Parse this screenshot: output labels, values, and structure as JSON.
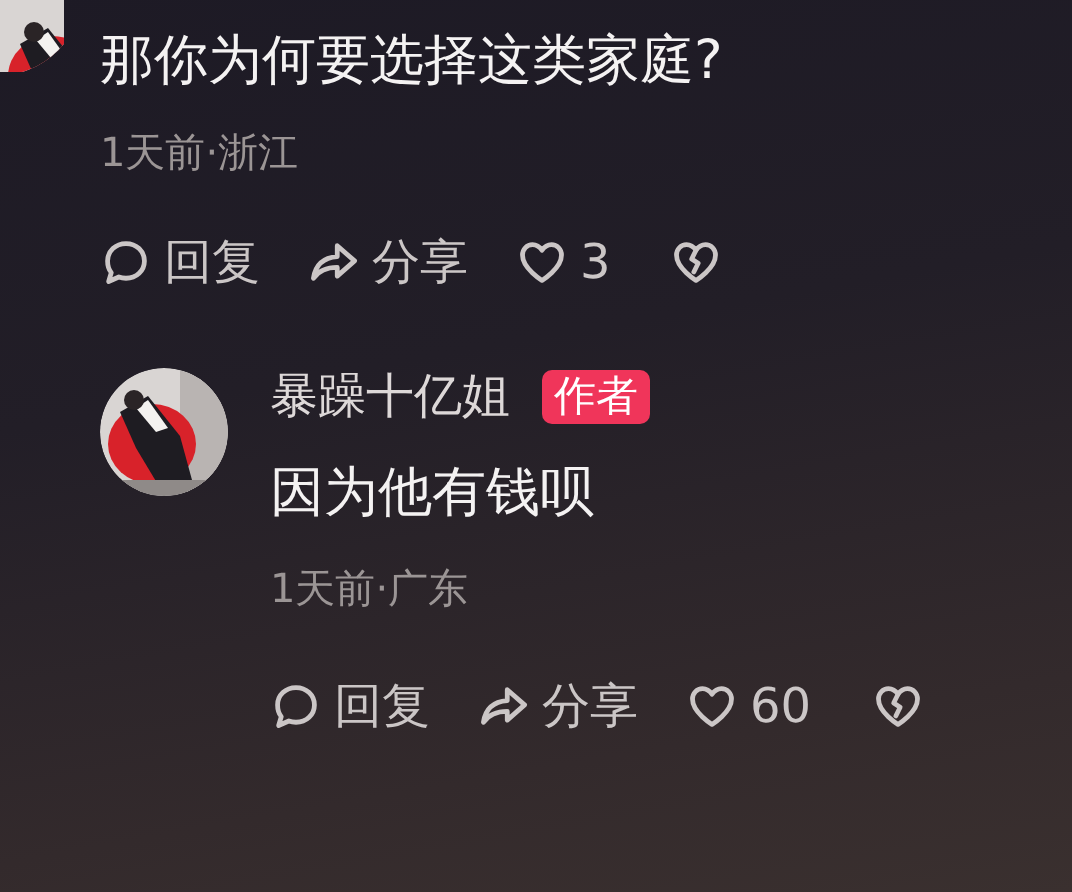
{
  "comments": [
    {
      "text": "那你为何要选择这类家庭?",
      "meta": "1天前·浙江",
      "actions": {
        "reply": "回复",
        "share": "分享",
        "likes": "3"
      },
      "replies": [
        {
          "author": "暴躁十亿姐",
          "badge": "作者",
          "text": "因为他有钱呗",
          "meta": "1天前·广东",
          "actions": {
            "reply": "回复",
            "share": "分享",
            "likes": "60"
          }
        }
      ]
    }
  ]
}
